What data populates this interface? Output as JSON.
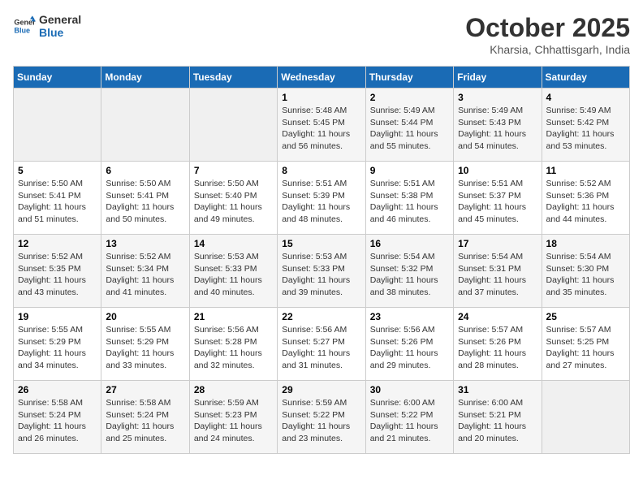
{
  "logo": {
    "line1": "General",
    "line2": "Blue"
  },
  "title": "October 2025",
  "subtitle": "Kharsia, Chhattisgarh, India",
  "days_header": [
    "Sunday",
    "Monday",
    "Tuesday",
    "Wednesday",
    "Thursday",
    "Friday",
    "Saturday"
  ],
  "weeks": [
    [
      {
        "num": "",
        "info": ""
      },
      {
        "num": "",
        "info": ""
      },
      {
        "num": "",
        "info": ""
      },
      {
        "num": "1",
        "info": "Sunrise: 5:48 AM\nSunset: 5:45 PM\nDaylight: 11 hours\nand 56 minutes."
      },
      {
        "num": "2",
        "info": "Sunrise: 5:49 AM\nSunset: 5:44 PM\nDaylight: 11 hours\nand 55 minutes."
      },
      {
        "num": "3",
        "info": "Sunrise: 5:49 AM\nSunset: 5:43 PM\nDaylight: 11 hours\nand 54 minutes."
      },
      {
        "num": "4",
        "info": "Sunrise: 5:49 AM\nSunset: 5:42 PM\nDaylight: 11 hours\nand 53 minutes."
      }
    ],
    [
      {
        "num": "5",
        "info": "Sunrise: 5:50 AM\nSunset: 5:41 PM\nDaylight: 11 hours\nand 51 minutes."
      },
      {
        "num": "6",
        "info": "Sunrise: 5:50 AM\nSunset: 5:41 PM\nDaylight: 11 hours\nand 50 minutes."
      },
      {
        "num": "7",
        "info": "Sunrise: 5:50 AM\nSunset: 5:40 PM\nDaylight: 11 hours\nand 49 minutes."
      },
      {
        "num": "8",
        "info": "Sunrise: 5:51 AM\nSunset: 5:39 PM\nDaylight: 11 hours\nand 48 minutes."
      },
      {
        "num": "9",
        "info": "Sunrise: 5:51 AM\nSunset: 5:38 PM\nDaylight: 11 hours\nand 46 minutes."
      },
      {
        "num": "10",
        "info": "Sunrise: 5:51 AM\nSunset: 5:37 PM\nDaylight: 11 hours\nand 45 minutes."
      },
      {
        "num": "11",
        "info": "Sunrise: 5:52 AM\nSunset: 5:36 PM\nDaylight: 11 hours\nand 44 minutes."
      }
    ],
    [
      {
        "num": "12",
        "info": "Sunrise: 5:52 AM\nSunset: 5:35 PM\nDaylight: 11 hours\nand 43 minutes."
      },
      {
        "num": "13",
        "info": "Sunrise: 5:52 AM\nSunset: 5:34 PM\nDaylight: 11 hours\nand 41 minutes."
      },
      {
        "num": "14",
        "info": "Sunrise: 5:53 AM\nSunset: 5:33 PM\nDaylight: 11 hours\nand 40 minutes."
      },
      {
        "num": "15",
        "info": "Sunrise: 5:53 AM\nSunset: 5:33 PM\nDaylight: 11 hours\nand 39 minutes."
      },
      {
        "num": "16",
        "info": "Sunrise: 5:54 AM\nSunset: 5:32 PM\nDaylight: 11 hours\nand 38 minutes."
      },
      {
        "num": "17",
        "info": "Sunrise: 5:54 AM\nSunset: 5:31 PM\nDaylight: 11 hours\nand 37 minutes."
      },
      {
        "num": "18",
        "info": "Sunrise: 5:54 AM\nSunset: 5:30 PM\nDaylight: 11 hours\nand 35 minutes."
      }
    ],
    [
      {
        "num": "19",
        "info": "Sunrise: 5:55 AM\nSunset: 5:29 PM\nDaylight: 11 hours\nand 34 minutes."
      },
      {
        "num": "20",
        "info": "Sunrise: 5:55 AM\nSunset: 5:29 PM\nDaylight: 11 hours\nand 33 minutes."
      },
      {
        "num": "21",
        "info": "Sunrise: 5:56 AM\nSunset: 5:28 PM\nDaylight: 11 hours\nand 32 minutes."
      },
      {
        "num": "22",
        "info": "Sunrise: 5:56 AM\nSunset: 5:27 PM\nDaylight: 11 hours\nand 31 minutes."
      },
      {
        "num": "23",
        "info": "Sunrise: 5:56 AM\nSunset: 5:26 PM\nDaylight: 11 hours\nand 29 minutes."
      },
      {
        "num": "24",
        "info": "Sunrise: 5:57 AM\nSunset: 5:26 PM\nDaylight: 11 hours\nand 28 minutes."
      },
      {
        "num": "25",
        "info": "Sunrise: 5:57 AM\nSunset: 5:25 PM\nDaylight: 11 hours\nand 27 minutes."
      }
    ],
    [
      {
        "num": "26",
        "info": "Sunrise: 5:58 AM\nSunset: 5:24 PM\nDaylight: 11 hours\nand 26 minutes."
      },
      {
        "num": "27",
        "info": "Sunrise: 5:58 AM\nSunset: 5:24 PM\nDaylight: 11 hours\nand 25 minutes."
      },
      {
        "num": "28",
        "info": "Sunrise: 5:59 AM\nSunset: 5:23 PM\nDaylight: 11 hours\nand 24 minutes."
      },
      {
        "num": "29",
        "info": "Sunrise: 5:59 AM\nSunset: 5:22 PM\nDaylight: 11 hours\nand 23 minutes."
      },
      {
        "num": "30",
        "info": "Sunrise: 6:00 AM\nSunset: 5:22 PM\nDaylight: 11 hours\nand 21 minutes."
      },
      {
        "num": "31",
        "info": "Sunrise: 6:00 AM\nSunset: 5:21 PM\nDaylight: 11 hours\nand 20 minutes."
      },
      {
        "num": "",
        "info": ""
      }
    ]
  ]
}
